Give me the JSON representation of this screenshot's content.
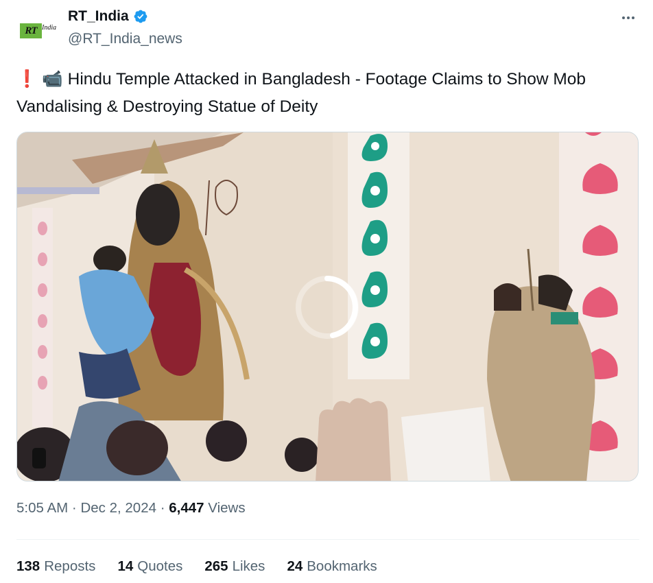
{
  "account": {
    "display_name": "RT_India",
    "handle": "@RT_India_news",
    "avatar_logo_text": "RT",
    "avatar_logo_sub": "India",
    "verified_color": "#1d9bf0"
  },
  "tweet": {
    "alert_emoji": "❗",
    "camera_emoji": "📹",
    "text": "Hindu Temple Attacked in Bangladesh - Footage Claims to Show Mob Vandalising & Destroying Statue of Deity"
  },
  "media": {
    "type": "video",
    "state": "loading"
  },
  "meta": {
    "time": "5:05 AM",
    "separator": "·",
    "date": "Dec 2, 2024",
    "views_count": "6,447",
    "views_label": "Views"
  },
  "stats": [
    {
      "count": "138",
      "label": "Reposts"
    },
    {
      "count": "14",
      "label": "Quotes"
    },
    {
      "count": "265",
      "label": "Likes"
    },
    {
      "count": "24",
      "label": "Bookmarks"
    }
  ],
  "colors": {
    "text_primary": "#0f1419",
    "text_secondary": "#536471",
    "alert_red": "#e0102a",
    "brand_green": "#6ab43e"
  }
}
